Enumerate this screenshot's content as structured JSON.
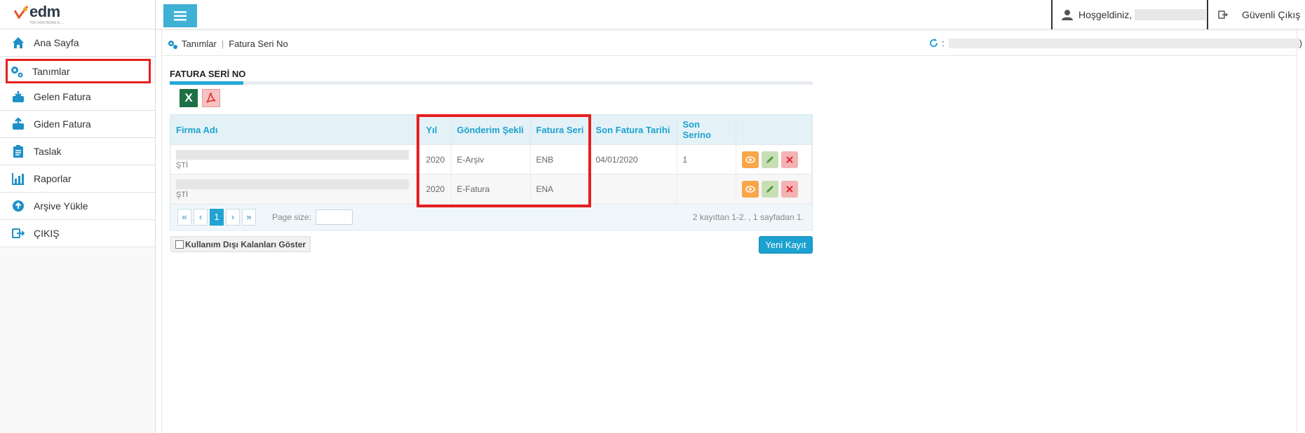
{
  "logo": {
    "text": "edm",
    "subtext": "TEK NOKTADAN E-..."
  },
  "sidebar": {
    "items": [
      {
        "label": "Ana Sayfa",
        "icon": "home-icon"
      },
      {
        "label": "Tanımlar",
        "icon": "gears-icon"
      },
      {
        "label": "Gelen Fatura",
        "icon": "inbox-in-icon"
      },
      {
        "label": "Giden Fatura",
        "icon": "inbox-out-icon"
      },
      {
        "label": "Taslak",
        "icon": "clipboard-icon"
      },
      {
        "label": "Raporlar",
        "icon": "chart-icon"
      },
      {
        "label": "Arşive Yükle",
        "icon": "upload-circle-icon"
      },
      {
        "label": "ÇIKIŞ",
        "icon": "exit-icon"
      }
    ]
  },
  "topbar": {
    "welcome": "Hoşgeldiniz,",
    "logout": "Güvenli Çıkış"
  },
  "breadcrumb": {
    "items": [
      "Tanımlar",
      "Fatura Seri No"
    ],
    "right_prefix": ":",
    "right_suffix": ")"
  },
  "section": {
    "title": "FATURA SERİ NO"
  },
  "grid": {
    "headers": [
      "Firma Adı",
      "Yıl",
      "Gönderim Şekli",
      "Fatura Seri",
      "Son Fatura Tarihi",
      "Son Serino",
      ""
    ],
    "rows": [
      {
        "firm_suffix": "ŞTİ",
        "year": "2020",
        "method": "E-Arşiv",
        "series": "ENB",
        "last_date": "04/01/2020",
        "last_serial": "1"
      },
      {
        "firm_suffix": "ŞTİ",
        "year": "2020",
        "method": "E-Fatura",
        "series": "ENA",
        "last_date": "",
        "last_serial": ""
      }
    ],
    "pager": {
      "current": "1",
      "page_size_label": "Page size:",
      "info": "2 kayıttan 1-2. , 1 sayfadan 1."
    }
  },
  "footer": {
    "show_unused": "Kullanım Dışı Kalanları Göster",
    "new_record": "Yeni Kayıt"
  },
  "colors": {
    "accent": "#1ea2cf",
    "highlight": "#e5201f",
    "excel": "#1d7044"
  }
}
